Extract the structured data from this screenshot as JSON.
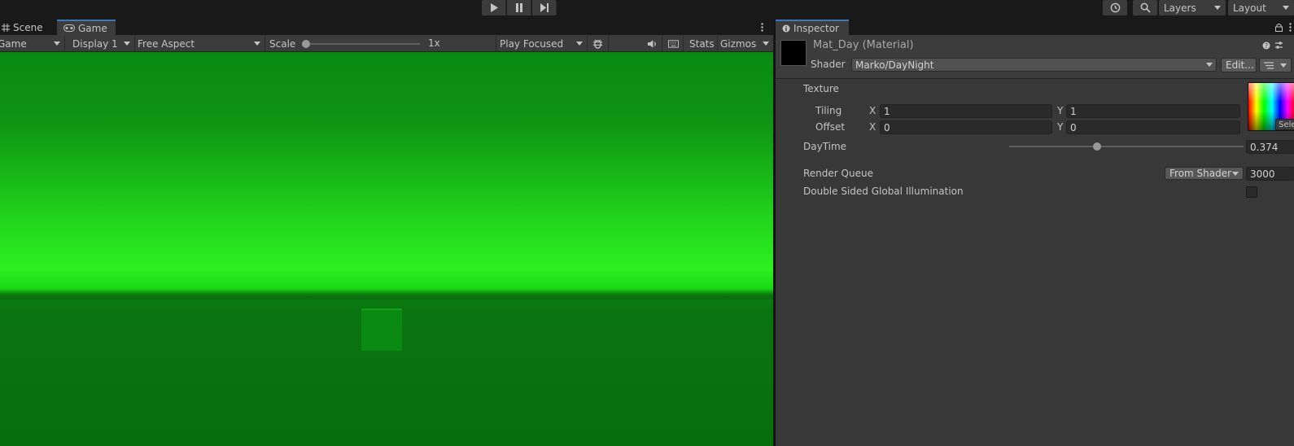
{
  "colors": {
    "accent": "#3a79bb",
    "panel": "#383838",
    "toolbar": "#3c3c3c",
    "sky_bright": "#2cf020",
    "ground": "#086e0c"
  },
  "toolbar": {
    "layers_label": "Layers",
    "layout_label": "Layout"
  },
  "game_panel": {
    "tabs": [
      {
        "label": "Scene",
        "icon": "grid-icon"
      },
      {
        "label": "Game",
        "icon": "gamepad-icon"
      }
    ],
    "game_view_selector": "Game",
    "display": "Display 1",
    "aspect": "Free Aspect",
    "scale_label": "Scale",
    "scale_value": "1x",
    "scale_level": 0,
    "play_mode": "Play Focused",
    "stats_label": "Stats",
    "gizmos_label": "Gizmos"
  },
  "inspector": {
    "tab_label": "Inspector",
    "material_name": "Mat_Day (Material)",
    "shader_label": "Shader",
    "shader_value": "Marko/DayNight",
    "edit_label": "Edit...",
    "texture_label": "Texture",
    "tiling_label": "Tiling",
    "offset_label": "Offset",
    "x_label": "X",
    "y_label": "Y",
    "tiling_x": "1",
    "tiling_y": "1",
    "offset_x": "0",
    "offset_y": "0",
    "select_label": "Select",
    "daytime_label": "DayTime",
    "daytime_value": "0.374",
    "daytime_level": 0.374,
    "render_queue_label": "Render Queue",
    "render_queue_source": "From Shader",
    "render_queue_value": "3000",
    "dsgi_label": "Double Sided Global Illumination",
    "dsgi_checked": false
  }
}
